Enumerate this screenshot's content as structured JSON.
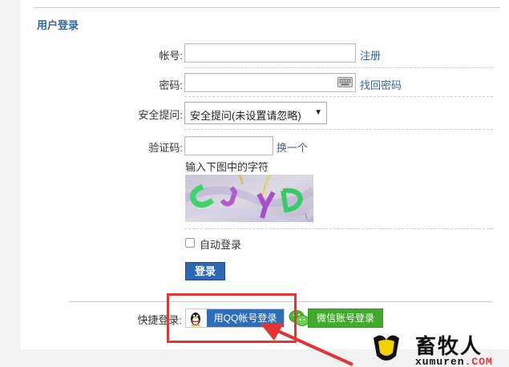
{
  "section_title": "用户登录",
  "form": {
    "account_label": "帐号:",
    "account_value": "",
    "register_link": "注册",
    "password_label": "密码:",
    "password_value": "",
    "forgot_password_link": "找回密码",
    "security_question_label": "安全提问:",
    "security_question_selected": "安全提问(未设置请忽略)",
    "captcha_label": "验证码:",
    "captcha_value": "",
    "refresh_captcha_link": "换一个",
    "captcha_hint": "输入下图中的字符",
    "captcha_text": "CJYD",
    "auto_login_label": "自动登录",
    "auto_login_checked": false,
    "login_button": "登录"
  },
  "quick_login": {
    "label": "快捷登录:",
    "qq_button": "用QQ帐号登录",
    "wechat_button": "微信账号登录"
  },
  "watermark": {
    "name": "畜牧人",
    "domain": "xumuren",
    "tld": ".COM"
  },
  "colors": {
    "title": "#336699",
    "link": "#336699",
    "login_button": "#2c68b4",
    "qq_button": "#2e6eb8",
    "wechat_button": "#42a92f",
    "highlight": "#e53434"
  },
  "icons": {
    "keyboard": "keyboard-icon",
    "qq": "qq-penguin-icon",
    "wechat": "wechat-icon"
  }
}
